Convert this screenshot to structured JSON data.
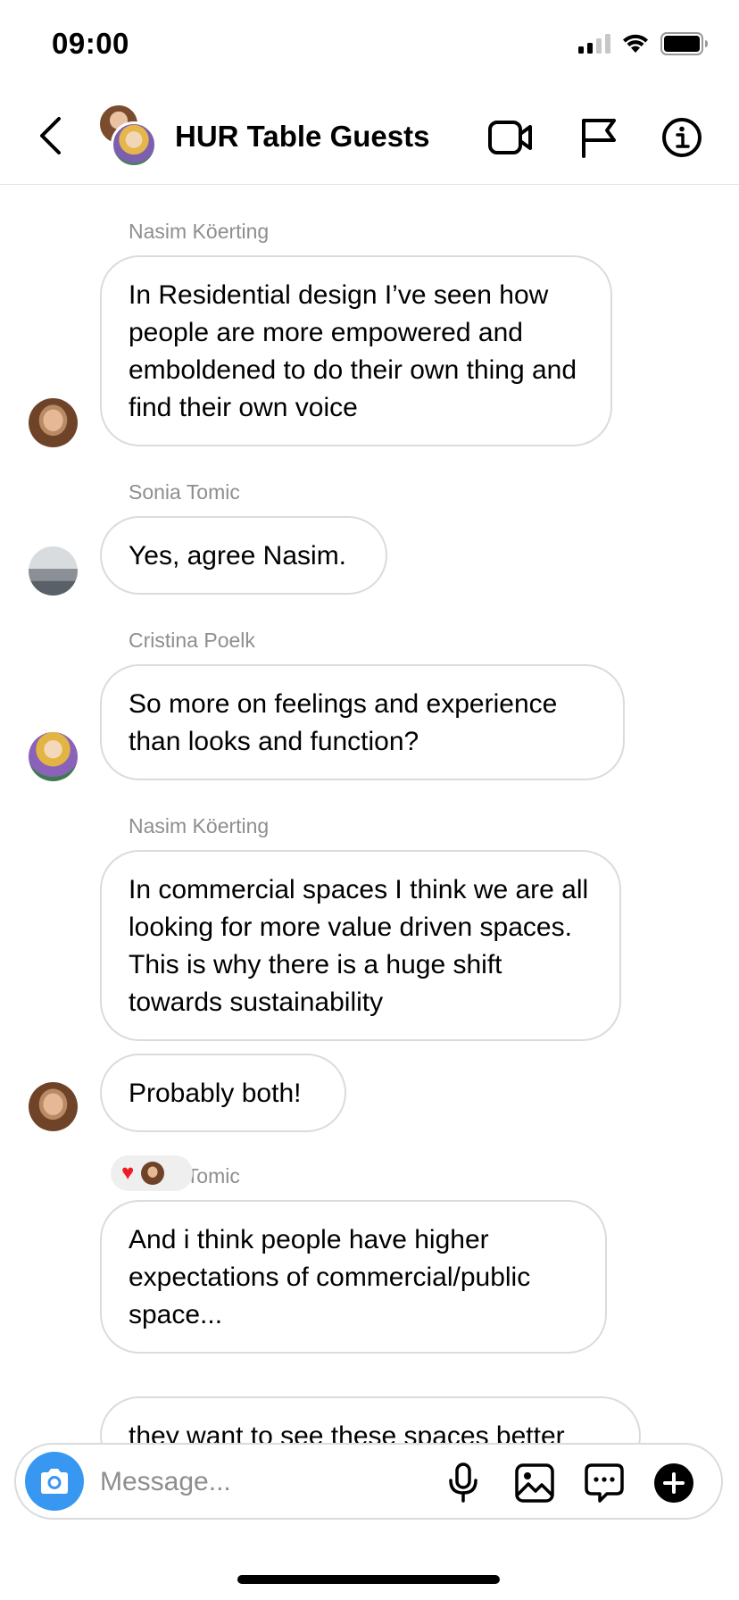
{
  "status_bar": {
    "time": "09:00",
    "icons": [
      "cellular-signal-icon",
      "wifi-icon",
      "battery-icon"
    ]
  },
  "header": {
    "title": "HUR Table Guests",
    "icons": [
      "back-chevron-icon",
      "video-call-icon",
      "flag-icon",
      "info-icon"
    ]
  },
  "messages": [
    {
      "sender": "Nasim Köerting",
      "text": "In Residential design I’ve seen how people are more empowered and emboldened to do their own thing and find their own voice"
    },
    {
      "sender": "Sonia Tomic",
      "text": "Yes, agree Nasim."
    },
    {
      "sender": "Cristina Poelk",
      "text": "So more on feelings and experience than looks and function?"
    },
    {
      "sender": "Nasim Köerting",
      "text": "In commercial spaces I think we are all looking for more value driven spaces. This is why there is a huge shift towards sustainability"
    },
    {
      "sender": "",
      "text": "Probably both!"
    },
    {
      "sender": "Sonia Tomic",
      "text": "And i think people have higher expectations of commercial/public space..."
    },
    {
      "sender": "",
      "text": "they want to see these spaces better"
    }
  ],
  "reaction": {
    "emoji": "❤️"
  },
  "composer": {
    "placeholder": "Message...",
    "icons": [
      "camera-icon",
      "microphone-icon",
      "gallery-icon",
      "sticker-icon",
      "plus-icon"
    ]
  },
  "colors": {
    "accent_blue": "#3897f0",
    "bubble_border": "#dbdbdb",
    "sender_gray": "#8e8e8e",
    "heart_red": "#ed1c24"
  }
}
